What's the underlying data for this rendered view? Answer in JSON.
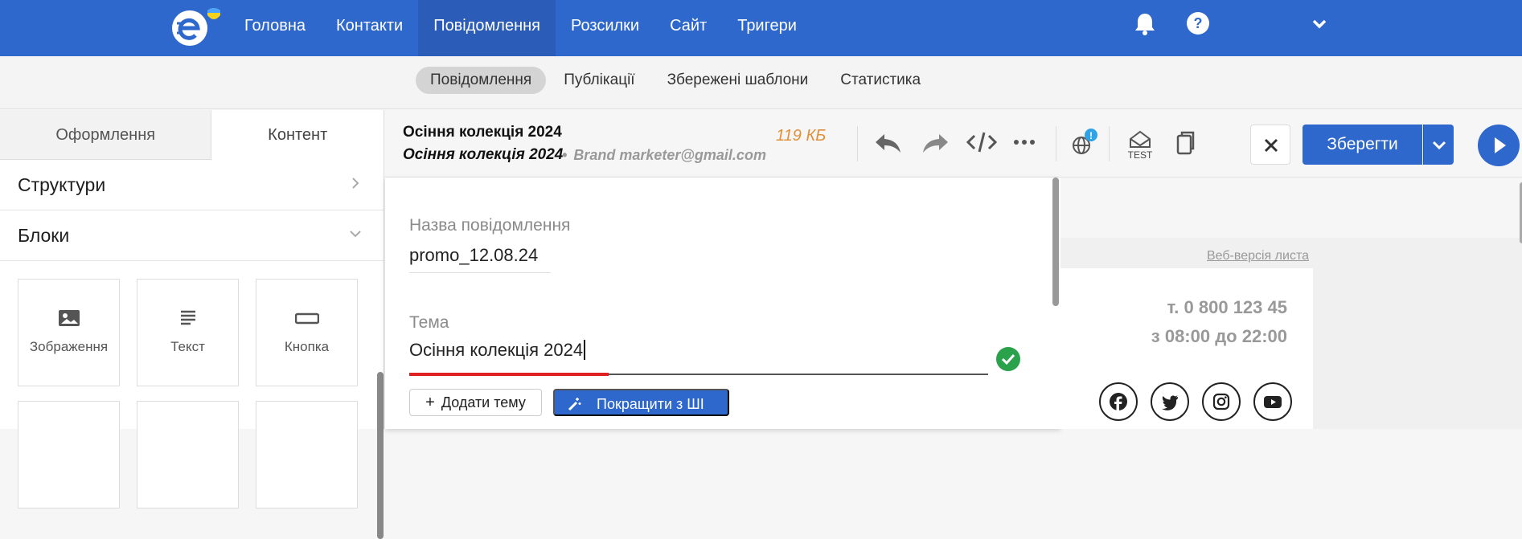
{
  "topnav": {
    "items": [
      "Головна",
      "Контакти",
      "Повідомлення",
      "Розсилки",
      "Сайт",
      "Тригери"
    ],
    "active_index": 2,
    "brand_color": "#2f68cc"
  },
  "subnav": {
    "items": [
      "Повідомлення",
      "Публікації",
      "Збережені шаблони",
      "Статистика"
    ],
    "active_index": 0
  },
  "left_panel": {
    "tabs": [
      "Оформлення",
      "Контент"
    ],
    "active_tab": 1,
    "sections": [
      {
        "label": "Структури",
        "state": "collapsed"
      },
      {
        "label": "Блоки",
        "state": "expanded"
      }
    ],
    "blocks": [
      {
        "label": "Зображення",
        "icon": "image-icon"
      },
      {
        "label": "Текст",
        "icon": "text-icon"
      },
      {
        "label": "Кнопка",
        "icon": "button-icon"
      }
    ]
  },
  "header": {
    "title": "Осіння колекція 2024",
    "subject": "Осіння колекція 2024",
    "sender": "Brand marketer@gmail.com",
    "size": "119 КБ",
    "test_label": "TEST",
    "save_label": "Зберегти"
  },
  "form": {
    "name_label": "Назва повідомлення",
    "name_value": "promo_12.08.24",
    "subject_label": "Тема",
    "subject_value": "Осіння колекція 2024",
    "add_subject_label": "Додати тему",
    "improve_ai_label": "Покращити з ШІ"
  },
  "preview": {
    "web_version": "Веб-версія листа",
    "phone": "т. 0 800 123 45",
    "hours": "з 08:00 до 22:00",
    "socials": [
      "facebook-icon",
      "twitter-icon",
      "instagram-icon",
      "youtube-icon"
    ]
  }
}
